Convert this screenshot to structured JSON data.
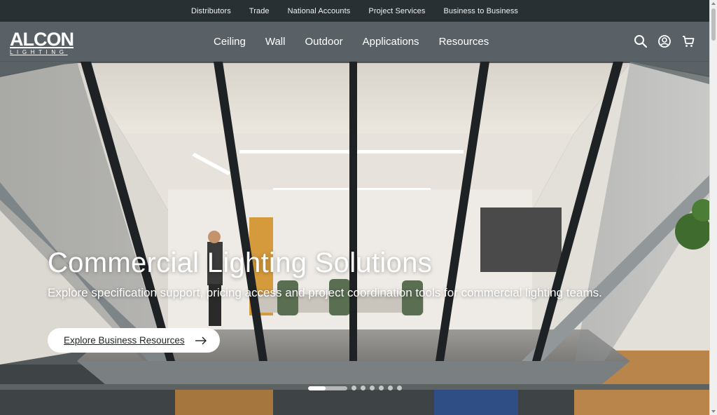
{
  "utility_nav": [
    "Distributors",
    "Trade",
    "National Accounts",
    "Project Services",
    "Business to Business"
  ],
  "logo": {
    "brand": "ALCON",
    "sub": "LIGHTING"
  },
  "main_nav": [
    "Ceiling",
    "Wall",
    "Outdoor",
    "Applications",
    "Resources"
  ],
  "icons": {
    "search": "search-icon",
    "account": "user-circle-icon",
    "cart": "cart-icon"
  },
  "hero": {
    "title": "Commercial Lighting Solutions",
    "subtitle": "Explore specification support, pricing access and project coordination tools for commercial lighting teams.",
    "cta_label": "Explore Business Resources"
  },
  "carousel": {
    "slides": 7,
    "active": 1,
    "progress": 0.45
  },
  "colors": {
    "utility_bg": "#262c30",
    "cta_bg": "#ffffff",
    "text": "#ffffff"
  }
}
